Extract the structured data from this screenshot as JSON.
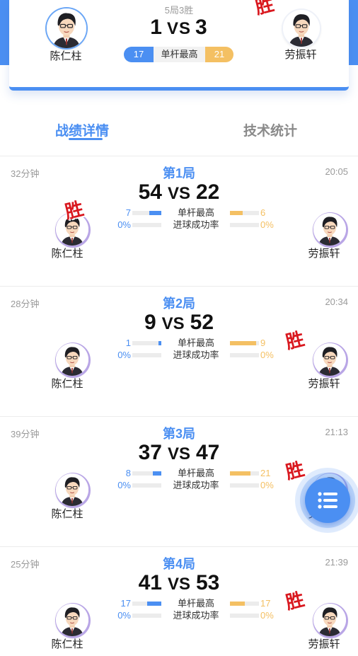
{
  "summary": {
    "record": "5局3胜",
    "left_score": "1",
    "vs": "VS",
    "right_score": "3",
    "left_player": "陈仁柱",
    "right_player": "劳振轩",
    "high_label": "单杆最高",
    "left_high": "17",
    "right_high": "21",
    "winner_stamp": "胜"
  },
  "tabs": [
    {
      "label": "战绩详情",
      "active": true
    },
    {
      "label": "技术统计",
      "active": false
    }
  ],
  "stat_labels": {
    "high": "单杆最高",
    "rate": "进球成功率"
  },
  "games": [
    {
      "title": "第1局",
      "duration": "32分钟",
      "time": "20:05",
      "left_score": "54",
      "right_score": "22",
      "left_player": "陈仁柱",
      "right_player": "劳振轩",
      "left_high": "7",
      "right_high": "6",
      "left_high_fill": 0.41,
      "right_high_fill": 0.44,
      "left_rate": "0%",
      "right_rate": "0%",
      "winner": "left",
      "stamp": "胜"
    },
    {
      "title": "第2局",
      "duration": "28分钟",
      "time": "20:34",
      "left_score": "9",
      "right_score": "52",
      "left_player": "陈仁柱",
      "right_player": "劳振轩",
      "left_high": "1",
      "right_high": "9",
      "left_high_fill": 0.1,
      "right_high_fill": 0.9,
      "left_rate": "0%",
      "right_rate": "0%",
      "winner": "right",
      "stamp": "胜"
    },
    {
      "title": "第3局",
      "duration": "39分钟",
      "time": "21:13",
      "left_score": "37",
      "right_score": "47",
      "left_player": "陈仁柱",
      "right_player": "劳振轩",
      "left_high": "8",
      "right_high": "21",
      "left_high_fill": 0.3,
      "right_high_fill": 0.7,
      "left_rate": "0%",
      "right_rate": "0%",
      "winner": "right",
      "stamp": "胜"
    },
    {
      "title": "第4局",
      "duration": "25分钟",
      "time": "21:39",
      "left_score": "41",
      "right_score": "53",
      "left_player": "陈仁柱",
      "right_player": "劳振轩",
      "left_high": "17",
      "right_high": "17",
      "left_high_fill": 0.5,
      "right_high_fill": 0.5,
      "left_rate": "0%",
      "right_rate": "0%",
      "winner": "right",
      "stamp": "胜"
    }
  ],
  "colors": {
    "primary": "#4b8ff2",
    "accent": "#f4c063",
    "win": "#d9181f"
  },
  "fab": {
    "icon": "list-menu-icon"
  }
}
